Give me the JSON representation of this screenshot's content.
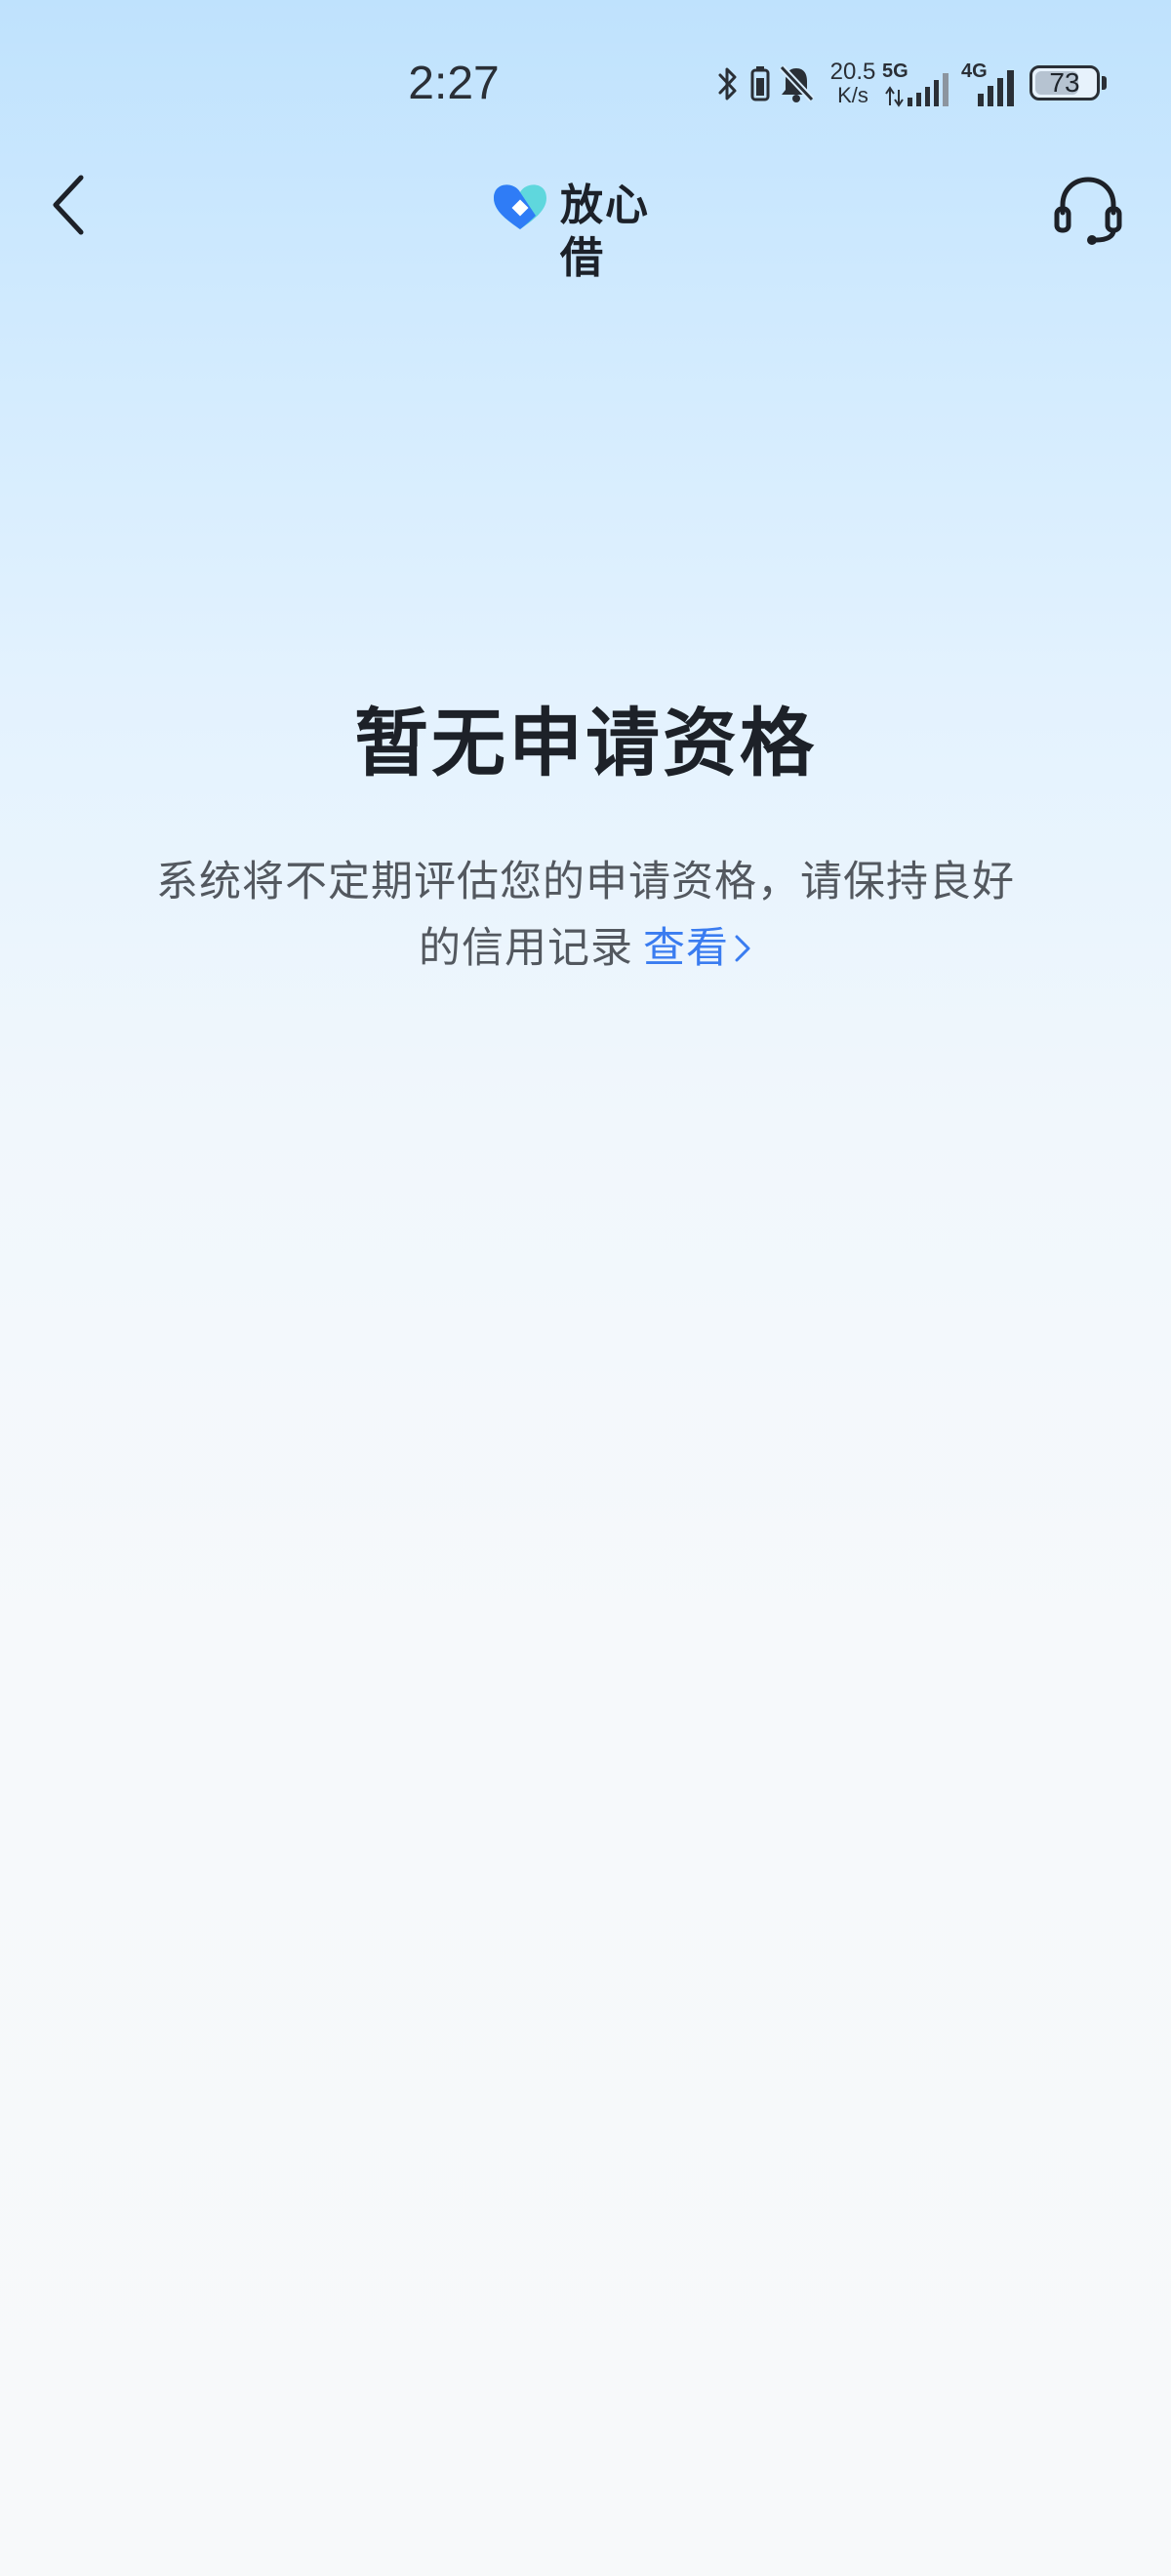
{
  "status_bar": {
    "time": "2:27",
    "net_speed_value": "20.5",
    "net_speed_unit": "K/s",
    "sim1_type": "5G",
    "sim2_type": "4G",
    "battery": "73",
    "battery_level": 0.73,
    "icons": [
      "bluetooth-icon",
      "vibrate-icon",
      "mute-bell-icon",
      "signal-5g-icon",
      "signal-4g-icon",
      "battery-icon"
    ]
  },
  "nav": {
    "logo_text": "放心借",
    "back_icon": "chevron-left-icon",
    "support_icon": "headset-icon"
  },
  "empty_state": {
    "title": "暂无申请资格",
    "description": "系统将不定期评估您的申请资格，请保持良好的信用记录",
    "link_label": "查看"
  },
  "colors": {
    "link": "#3a7cf0",
    "title": "#1d2128",
    "body_text": "#53585f",
    "logo_blue": "#2f7cf6",
    "logo_cyan": "#5fd7dd"
  }
}
